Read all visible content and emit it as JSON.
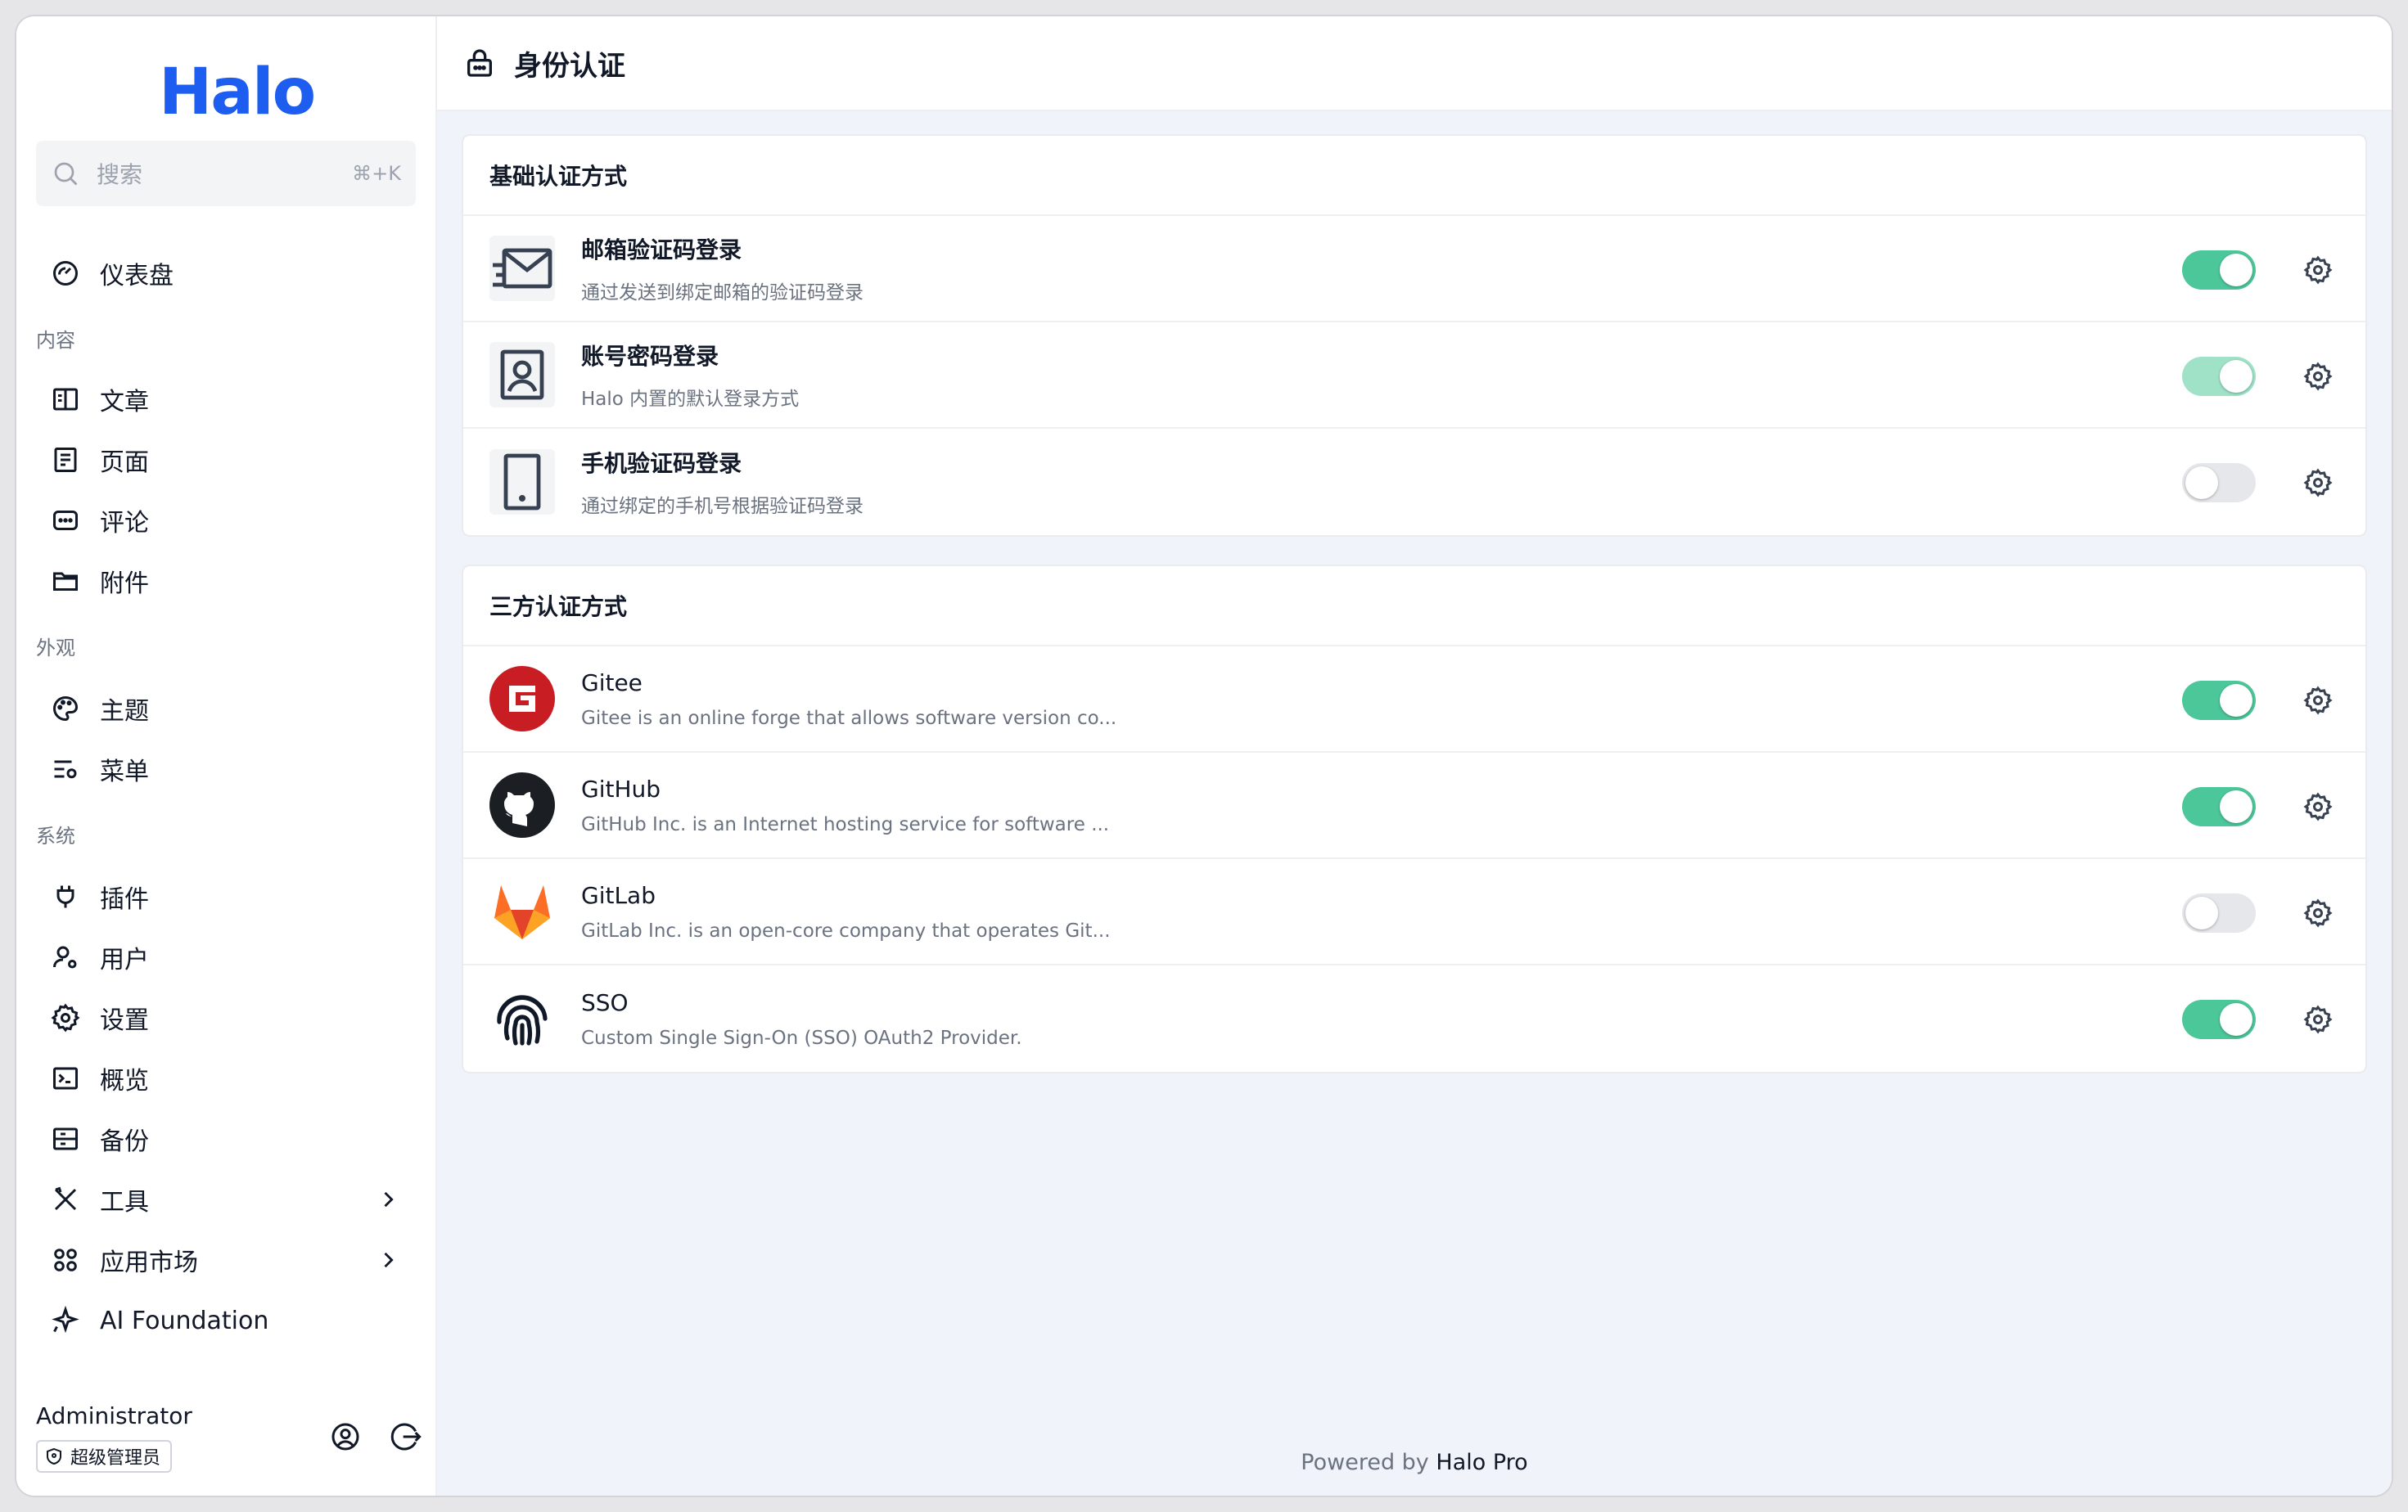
{
  "app": {
    "logo": "Halo"
  },
  "search": {
    "placeholder": "搜索",
    "shortcut": "⌘+K"
  },
  "nav": {
    "dashboard": "仪表盘",
    "group_content": "内容",
    "posts": "文章",
    "pages": "页面",
    "comments": "评论",
    "attachments": "附件",
    "group_appearance": "外观",
    "themes": "主题",
    "menus": "菜单",
    "group_system": "系统",
    "plugins": "插件",
    "users": "用户",
    "settings": "设置",
    "overview": "概览",
    "backup": "备份",
    "tools": "工具",
    "app_market": "应用市场",
    "ai_foundation": "AI Foundation"
  },
  "user": {
    "name": "Administrator",
    "role": "超级管理员"
  },
  "header": {
    "title": "身份认证"
  },
  "basic": {
    "title": "基础认证方式",
    "items": [
      {
        "name": "邮箱验证码登录",
        "desc": "通过发送到绑定邮箱的验证码登录",
        "enabled": true
      },
      {
        "name": "账号密码登录",
        "desc": "Halo 内置的默认登录方式",
        "enabled": true
      },
      {
        "name": "手机验证码登录",
        "desc": "通过绑定的手机号根据验证码登录",
        "enabled": false
      }
    ]
  },
  "third": {
    "title": "三方认证方式",
    "items": [
      {
        "name": "Gitee",
        "desc": "Gitee is an online forge that allows software version co...",
        "enabled": true
      },
      {
        "name": "GitHub",
        "desc": "GitHub Inc. is an Internet hosting service for software ...",
        "enabled": true
      },
      {
        "name": "GitLab",
        "desc": "GitLab Inc. is an open-core company that operates Git...",
        "enabled": false
      },
      {
        "name": "SSO",
        "desc": "Custom Single Sign-On (SSO) OAuth2 Provider.",
        "enabled": true
      }
    ]
  },
  "footer": {
    "prefix": "Powered by",
    "brand": "Halo Pro"
  },
  "colors": {
    "accent": "#1d5ef0",
    "toggle_on": "#4cc79a",
    "gitee": "#c71d23",
    "gitlab": "#fc6d26"
  }
}
